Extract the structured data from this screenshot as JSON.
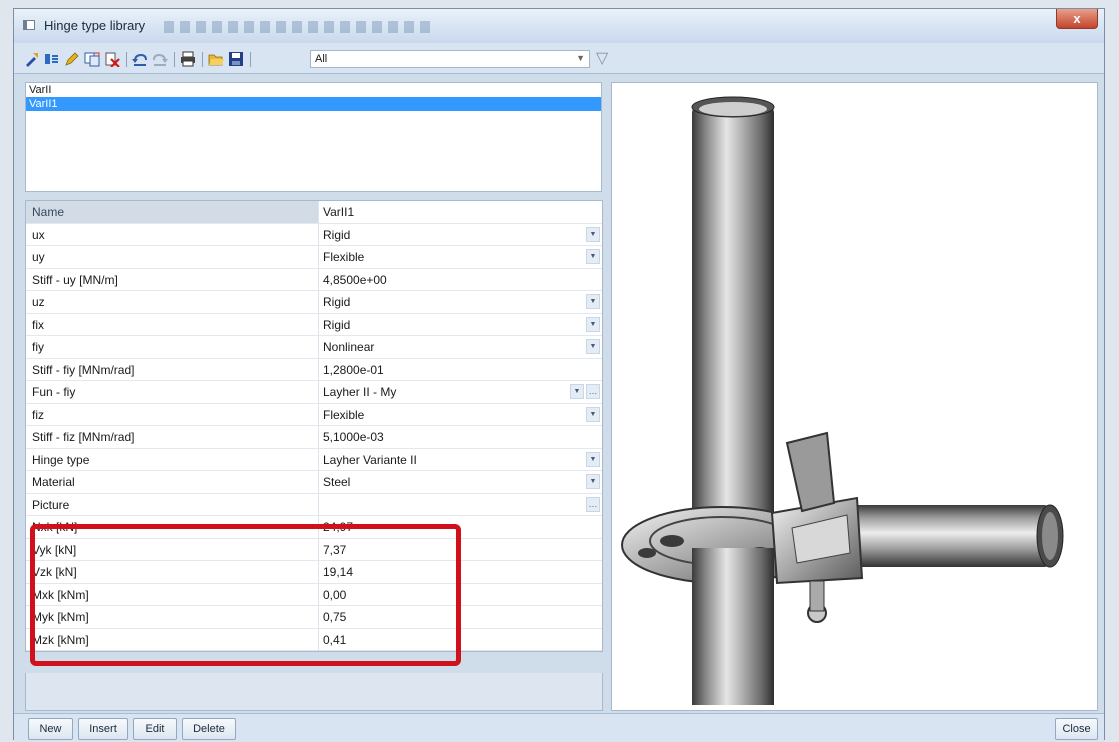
{
  "window": {
    "title": "Hinge type library",
    "close_glyph": "x"
  },
  "toolbar": {
    "filter_value": "All",
    "icons": [
      "new-icon",
      "insert-icon",
      "edit-icon",
      "copy-icon",
      "delete-icon",
      "undo-icon",
      "redo-icon",
      "print-icon",
      "open-icon",
      "save-icon"
    ]
  },
  "list": {
    "items": [
      "VarII",
      "VarII1"
    ],
    "selected_index": 1
  },
  "properties": {
    "name": {
      "label": "Name",
      "value": "VarII1"
    },
    "rows": [
      {
        "label": "ux",
        "value": "Rigid"
      },
      {
        "label": "uy",
        "value": "Flexible"
      },
      {
        "label": "Stiff - uy [MN/m]",
        "value": "4,8500e+00"
      },
      {
        "label": "uz",
        "value": "Rigid"
      },
      {
        "label": "fix",
        "value": "Rigid"
      },
      {
        "label": "fiy",
        "value": "Nonlinear"
      },
      {
        "label": "Stiff - fiy [MNm/rad]",
        "value": "1,2800e-01"
      },
      {
        "label": "Fun - fiy",
        "value": "Layher II - My"
      },
      {
        "label": "fiz",
        "value": "Flexible"
      },
      {
        "label": "Stiff - fiz [MNm/rad]",
        "value": "5,1000e-03"
      },
      {
        "label": "Hinge type",
        "value": "Layher Variante II"
      },
      {
        "label": "Material",
        "value": "Steel"
      },
      {
        "label": "Picture",
        "value": ""
      },
      {
        "label": "Nxk [kN]",
        "value": "24,97"
      },
      {
        "label": "Vyk [kN]",
        "value": "7,37"
      },
      {
        "label": "Vzk [kN]",
        "value": "19,14"
      },
      {
        "label": "Mxk [kNm]",
        "value": "0,00"
      },
      {
        "label": "Myk [kNm]",
        "value": "0,75"
      },
      {
        "label": "Mzk [kNm]",
        "value": "0,41"
      }
    ]
  },
  "buttons": {
    "new": "New",
    "insert": "Insert",
    "edit": "Edit",
    "delete": "Delete",
    "close": "Close"
  },
  "colors": {
    "highlight": "#d0101a",
    "selection": "#3399ff"
  }
}
